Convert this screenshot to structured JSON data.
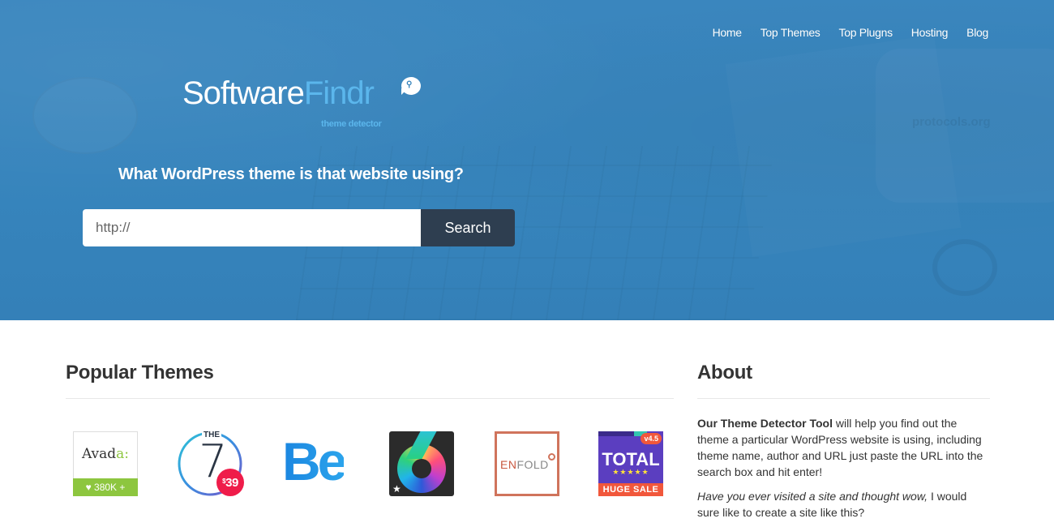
{
  "nav": {
    "items": [
      {
        "label": "Home"
      },
      {
        "label": "Top Themes"
      },
      {
        "label": "Top Plugns"
      },
      {
        "label": "Hosting"
      },
      {
        "label": "Blog"
      }
    ]
  },
  "logo": {
    "part1": "Software",
    "part2": "Findr",
    "subtitle": "theme detector",
    "bubble_icon": "search-icon",
    "bubble_glyph": "🔍"
  },
  "hero": {
    "tagline": "What WordPress theme is that website using?",
    "search_placeholder": "http://",
    "search_value": "",
    "search_button": "Search",
    "background_watermark": "protocols.org"
  },
  "popular": {
    "title": "Popular Themes",
    "themes": [
      {
        "name": "Avada",
        "logo_text_main": "Avad",
        "logo_text_accent": "a:",
        "badge": "♥ 380K +",
        "accent": "#8dc63f"
      },
      {
        "name": "The7",
        "top_text": "THE",
        "number": "7",
        "price": "39",
        "price_symbol": "$",
        "accent": "#ef1c4a"
      },
      {
        "name": "Be",
        "logo_text": "Be",
        "accent": "#1e90e4"
      },
      {
        "name": "Six",
        "star": "★"
      },
      {
        "name": "Enfold",
        "logo_text_main": "EN",
        "logo_text_rest": "FOLD",
        "accent": "#d0745c"
      },
      {
        "name": "Total",
        "version": "v4.5",
        "logo_text": "TOTAL",
        "stars": "★★★★★",
        "sale": "HUGE SALE",
        "accent": "#f1573b"
      }
    ]
  },
  "about": {
    "title": "About",
    "p1_bold": "Our Theme Detector Tool",
    "p1_rest": " will help you find out the theme a particular WordPress website is using, including theme name, author and URL just paste the URL into the search box and hit enter!",
    "p2_italic": "Have you ever visited a site and thought wow,",
    "p2_rest": " I would sure like to create a site like this?"
  },
  "colors": {
    "hero_bg": "#3583bb",
    "brand_light": "#5bb6ec",
    "search_button_bg": "#2e3e50"
  }
}
